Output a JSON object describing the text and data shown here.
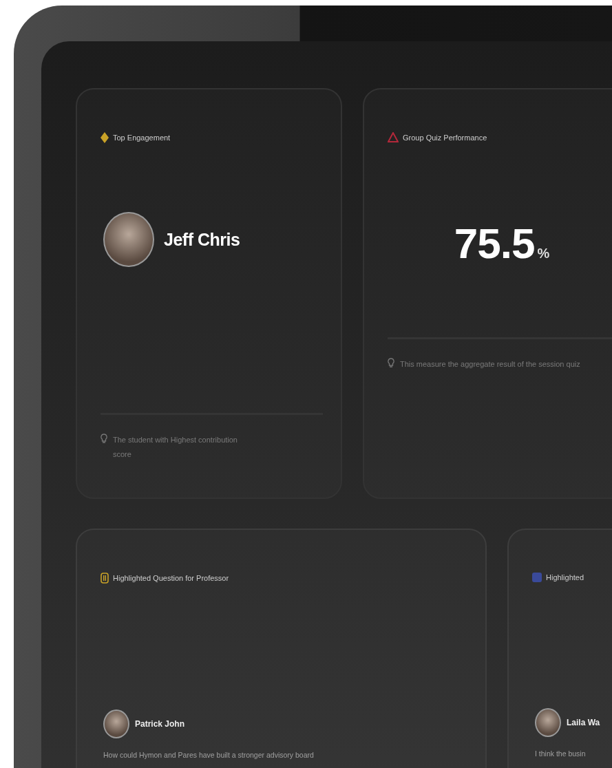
{
  "cards": [
    {
      "kind": "person",
      "title": "Top Engagement",
      "name": "Jeff Chris",
      "hint": "The student with Highest contribution score"
    },
    {
      "kind": "metric",
      "title": "Group Quiz Performance",
      "value": "75.5",
      "unit": "%",
      "hint": "This measure the aggregate result of the session quiz"
    },
    {
      "kind": "quote",
      "title": "Highlighted Question for Professor",
      "author": "Patrick John",
      "text": "How could Hymon and Pares have built a stronger advisory board"
    },
    {
      "kind": "quote",
      "title": "Highlighted",
      "author": "Laila Wa",
      "text": "I think the busin"
    }
  ]
}
